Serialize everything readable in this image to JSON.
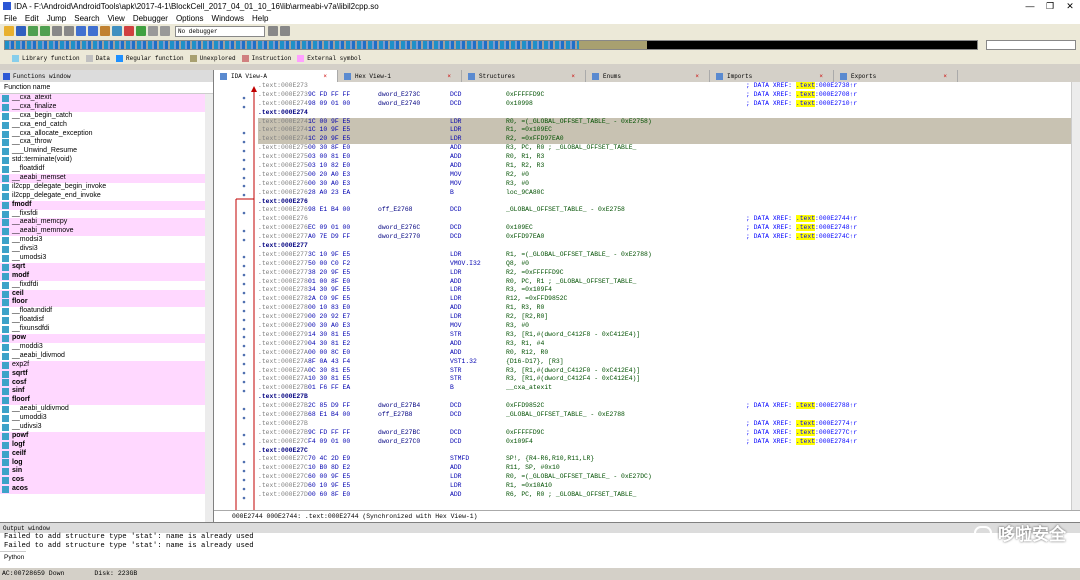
{
  "window": {
    "title": "IDA - F:\\Android\\AndroidTools\\apk\\2017-4-1\\BlockCell_2017_04_01_10_16\\lib\\armeabi-v7a\\libil2cpp.so",
    "min": "—",
    "max": "❐",
    "close": "✕"
  },
  "menu": [
    "File",
    "Edit",
    "Jump",
    "Search",
    "View",
    "Debugger",
    "Options",
    "Windows",
    "Help"
  ],
  "toolbar": {
    "debugger": "No debugger"
  },
  "legend": [
    {
      "label": "Library function",
      "color": "#87ceeb"
    },
    {
      "label": "Data",
      "color": "#c0c0c0"
    },
    {
      "label": "Regular function",
      "color": "#1e90ff"
    },
    {
      "label": "Unexplored",
      "color": "#a8a070"
    },
    {
      "label": "Instruction",
      "color": "#d08080"
    },
    {
      "label": "External symbol",
      "color": "#ffa0ff"
    }
  ],
  "functions": {
    "title": "Functions window",
    "column": "Function name",
    "items": [
      {
        "name": "__cxa_atexit",
        "lib": true
      },
      {
        "name": "__cxa_finalize",
        "lib": true
      },
      {
        "name": "__cxa_begin_catch",
        "lib": false
      },
      {
        "name": "__cxa_end_catch",
        "lib": false
      },
      {
        "name": "__cxa_allocate_exception",
        "lib": false
      },
      {
        "name": "__cxa_throw",
        "lib": false
      },
      {
        "name": "___Unwind_Resume",
        "lib": false
      },
      {
        "name": "std::terminate(void)",
        "lib": false
      },
      {
        "name": "__floatdidf",
        "lib": false
      },
      {
        "name": "__aeabi_memset",
        "lib": true
      },
      {
        "name": "il2cpp_delegate_begin_invoke",
        "lib": false
      },
      {
        "name": "il2cpp_delegate_end_invoke",
        "lib": false
      },
      {
        "name": "fmodf",
        "lib": true,
        "bold": true
      },
      {
        "name": "__fixsfdi",
        "lib": false
      },
      {
        "name": "__aeabi_memcpy",
        "lib": true
      },
      {
        "name": "__aeabi_memmove",
        "lib": true
      },
      {
        "name": "__modsi3",
        "lib": false
      },
      {
        "name": "__divsi3",
        "lib": false
      },
      {
        "name": "__umodsi3",
        "lib": false
      },
      {
        "name": "sqrt",
        "lib": true,
        "bold": true
      },
      {
        "name": "modf",
        "lib": true,
        "bold": true
      },
      {
        "name": "__fixdfdi",
        "lib": false
      },
      {
        "name": "ceil",
        "lib": true,
        "bold": true
      },
      {
        "name": "floor",
        "lib": true,
        "bold": true
      },
      {
        "name": "__floatundidf",
        "lib": false
      },
      {
        "name": "__floatdisf",
        "lib": false
      },
      {
        "name": "__fixunsdfdi",
        "lib": false
      },
      {
        "name": "pow",
        "lib": true,
        "bold": true
      },
      {
        "name": "__moddi3",
        "lib": false
      },
      {
        "name": "__aeabi_ldivmod",
        "lib": false
      },
      {
        "name": "exp2f",
        "lib": true
      },
      {
        "name": "sqrtf",
        "lib": true,
        "bold": true
      },
      {
        "name": "cosf",
        "lib": true,
        "bold": true
      },
      {
        "name": "sinf",
        "lib": true,
        "bold": true
      },
      {
        "name": "floorf",
        "lib": true,
        "bold": true
      },
      {
        "name": "__aeabi_uldivmod",
        "lib": false
      },
      {
        "name": "__umoddi3",
        "lib": false
      },
      {
        "name": "__udivsi3",
        "lib": false
      },
      {
        "name": "powf",
        "lib": true,
        "bold": true
      },
      {
        "name": "logf",
        "lib": true,
        "bold": true
      },
      {
        "name": "ceilf",
        "lib": true,
        "bold": true
      },
      {
        "name": "log",
        "lib": true,
        "bold": true
      },
      {
        "name": "sin",
        "lib": true,
        "bold": true
      },
      {
        "name": "cos",
        "lib": true,
        "bold": true
      },
      {
        "name": "acos",
        "lib": true,
        "bold": true
      }
    ]
  },
  "tabs": [
    {
      "label": "IDA View-A",
      "active": true
    },
    {
      "label": "Hex View-1",
      "active": false
    },
    {
      "label": "Structures",
      "active": false
    },
    {
      "label": "Enums",
      "active": false
    },
    {
      "label": "Imports",
      "active": false
    },
    {
      "label": "Exports",
      "active": false
    }
  ],
  "disasm": [
    {
      "a": ".text:000E2738",
      "b": "",
      "l": "",
      "m": "",
      "o": "",
      "c": "; DATA XREF: .text:000E2738↑r"
    },
    {
      "a": ".text:000E273C",
      "b": "9C FD FF FF",
      "l": "dword_E273C",
      "m": "DCD",
      "o": "0xFFFFFD9C",
      "c": "; DATA XREF: .text:000E2708↑r"
    },
    {
      "a": ".text:000E2740",
      "b": "98 09 01 00",
      "l": "dword_E2740",
      "m": "DCD",
      "o": "0x10998",
      "c": "; DATA XREF: .text:000E2710↑r"
    },
    {
      "a": ".text:000E2744",
      "b": "",
      "l": "",
      "m": "",
      "o": "",
      "c": "",
      "lbl": true
    },
    {
      "a": ".text:000E2744",
      "b": "1C 00 9F E5",
      "l": "",
      "m": "LDR",
      "o": "R0, =(_GLOBAL_OFFSET_TABLE_ - 0xE2758)",
      "c": "",
      "hl": true
    },
    {
      "a": ".text:000E2748",
      "b": "1C 10 9F E5",
      "l": "",
      "m": "LDR",
      "o": "R1, =0x109EC",
      "c": "",
      "hl": true
    },
    {
      "a": ".text:000E274C",
      "b": "1C 20 9F E5",
      "l": "",
      "m": "LDR",
      "o": "R2, =0xFFD97EA0",
      "c": "",
      "hl": true
    },
    {
      "a": ".text:000E2750",
      "b": "00 30 8F E0",
      "l": "",
      "m": "ADD",
      "o": "R3, PC, R0 ; _GLOBAL_OFFSET_TABLE_",
      "c": ""
    },
    {
      "a": ".text:000E2754",
      "b": "03 00 81 E0",
      "l": "",
      "m": "ADD",
      "o": "R0, R1, R3",
      "c": ""
    },
    {
      "a": ".text:000E2758",
      "b": "03 10 82 E0",
      "l": "",
      "m": "ADD",
      "o": "R1, R2, R3",
      "c": ""
    },
    {
      "a": ".text:000E275C",
      "b": "00 20 A0 E3",
      "l": "",
      "m": "MOV",
      "o": "R2, #0",
      "c": ""
    },
    {
      "a": ".text:000E2760",
      "b": "00 30 A0 E3",
      "l": "",
      "m": "MOV",
      "o": "R3, #0",
      "c": ""
    },
    {
      "a": ".text:000E2764",
      "b": "28 A0 23 EA",
      "l": "",
      "m": "B",
      "o": "loc_9CA80C",
      "c": ""
    },
    {
      "a": ".text:000E2764",
      "b": "",
      "l": "",
      "m": "",
      "o": "",
      "c": "",
      "lbl": true
    },
    {
      "a": ".text:000E2768",
      "b": "98 E1 B4 00",
      "l": "off_E2768",
      "m": "DCD",
      "o": "_GLOBAL_OFFSET_TABLE_ - 0xE2758",
      "c": ""
    },
    {
      "a": ".text:000E2768",
      "b": "",
      "l": "",
      "m": "",
      "o": "",
      "c": "; DATA XREF: .text:000E2744↑r"
    },
    {
      "a": ".text:000E276C",
      "b": "EC 09 01 00",
      "l": "dword_E276C",
      "m": "DCD",
      "o": "0x109EC",
      "c": "; DATA XREF: .text:000E2748↑r"
    },
    {
      "a": ".text:000E2770",
      "b": "A0 7E D9 FF",
      "l": "dword_E2770",
      "m": "DCD",
      "o": "0xFFD97EA0",
      "c": "; DATA XREF: .text:000E274C↑r"
    },
    {
      "a": ".text:000E2774",
      "b": "",
      "l": "",
      "m": "",
      "o": "",
      "c": "",
      "lbl": true
    },
    {
      "a": ".text:000E2774",
      "b": "3C 10 9F E5",
      "l": "",
      "m": "LDR",
      "o": "R1, =(_GLOBAL_OFFSET_TABLE_ - 0xE2788)",
      "c": ""
    },
    {
      "a": ".text:000E2778",
      "b": "50 00 C0 F2",
      "l": "",
      "m": "VMOV.I32",
      "o": "Q8, #0",
      "c": ""
    },
    {
      "a": ".text:000E277C",
      "b": "38 20 9F E5",
      "l": "",
      "m": "LDR",
      "o": "R2, =0xFFFFFD9C",
      "c": ""
    },
    {
      "a": ".text:000E2780",
      "b": "01 00 8F E0",
      "l": "",
      "m": "ADD",
      "o": "R0, PC, R1 ; _GLOBAL_OFFSET_TABLE_",
      "c": ""
    },
    {
      "a": ".text:000E2784",
      "b": "34 30 9F E5",
      "l": "",
      "m": "LDR",
      "o": "R3, =0x109F4",
      "c": ""
    },
    {
      "a": ".text:000E2788",
      "b": "2A C0 9F E5",
      "l": "",
      "m": "LDR",
      "o": "R12, =0xFFD9852C",
      "c": ""
    },
    {
      "a": ".text:000E278C",
      "b": "00 10 83 E0",
      "l": "",
      "m": "ADD",
      "o": "R1, R3, R0",
      "c": ""
    },
    {
      "a": ".text:000E2790",
      "b": "00 20 92 E7",
      "l": "",
      "m": "LDR",
      "o": "R2, [R2,R0]",
      "c": ""
    },
    {
      "a": ".text:000E2794",
      "b": "00 30 A0 E3",
      "l": "",
      "m": "MOV",
      "o": "R3, #0",
      "c": ""
    },
    {
      "a": ".text:000E2798",
      "b": "14 30 81 E5",
      "l": "",
      "m": "STR",
      "o": "R3, [R1,#(dword_C412F8 - 0xC412E4)]",
      "c": ""
    },
    {
      "a": ".text:000E279C",
      "b": "04 30 81 E2",
      "l": "",
      "m": "ADD",
      "o": "R3, R1, #4",
      "c": ""
    },
    {
      "a": ".text:000E27A0",
      "b": "00 00 8C E0",
      "l": "",
      "m": "ADD",
      "o": "R0, R12, R0",
      "c": ""
    },
    {
      "a": ".text:000E27A4",
      "b": "8F 0A 43 F4",
      "l": "",
      "m": "VST1.32",
      "o": "{D16-D17}, [R3]",
      "c": ""
    },
    {
      "a": ".text:000E27A8",
      "b": "0C 30 81 E5",
      "l": "",
      "m": "STR",
      "o": "R3, [R1,#(dword_C412F0 - 0xC412E4)]",
      "c": ""
    },
    {
      "a": ".text:000E27AC",
      "b": "10 30 81 E5",
      "l": "",
      "m": "STR",
      "o": "R3, [R1,#(dword_C412F4 - 0xC412E4)]",
      "c": ""
    },
    {
      "a": ".text:000E27B0",
      "b": "01 F6 FF EA",
      "l": "",
      "m": "B",
      "o": "__cxa_atexit",
      "c": ""
    },
    {
      "a": ".text:000E27B0",
      "b": "",
      "l": "",
      "m": "",
      "o": "",
      "c": "",
      "lbl": true
    },
    {
      "a": ".text:000E27B4",
      "b": "2C 85 D9 FF",
      "l": "dword_E27B4",
      "m": "DCD",
      "o": "0xFFD9852C",
      "c": "; DATA XREF: .text:000E2788↑r"
    },
    {
      "a": ".text:000E27B8",
      "b": "68 E1 B4 00",
      "l": "off_E27B8",
      "m": "DCD",
      "o": "_GLOBAL_OFFSET_TABLE_ - 0xE2788",
      "c": ""
    },
    {
      "a": ".text:000E27B8",
      "b": "",
      "l": "",
      "m": "",
      "o": "",
      "c": "; DATA XREF: .text:000E2774↑r"
    },
    {
      "a": ".text:000E27BC",
      "b": "9C FD FF FF",
      "l": "dword_E27BC",
      "m": "DCD",
      "o": "0xFFFFFD9C",
      "c": "; DATA XREF: .text:000E277C↑r"
    },
    {
      "a": ".text:000E27C0",
      "b": "F4 09 01 00",
      "l": "dword_E27C0",
      "m": "DCD",
      "o": "0x109F4",
      "c": "; DATA XREF: .text:000E2784↑r"
    },
    {
      "a": ".text:000E27C4",
      "b": "",
      "l": "",
      "m": "",
      "o": "",
      "c": "",
      "lbl": true
    },
    {
      "a": ".text:000E27C4",
      "b": "70 4C 2D E9",
      "l": "",
      "m": "STMFD",
      "o": "SP!, {R4-R6,R10,R11,LR}",
      "c": ""
    },
    {
      "a": ".text:000E27C8",
      "b": "10 B0 8D E2",
      "l": "",
      "m": "ADD",
      "o": "R11, SP, #0x10",
      "c": ""
    },
    {
      "a": ".text:000E27CC",
      "b": "60 00 9F E5",
      "l": "",
      "m": "LDR",
      "o": "R0, =(_GLOBAL_OFFSET_TABLE_ - 0xE27DC)",
      "c": ""
    },
    {
      "a": ".text:000E27D0",
      "b": "60 10 9F E5",
      "l": "",
      "m": "LDR",
      "o": "R1, =0x10A10",
      "c": ""
    },
    {
      "a": ".text:000E27D4",
      "b": "00 60 8F E0",
      "l": "",
      "m": "ADD",
      "o": "R6, PC, R0 ; _GLOBAL_OFFSET_TABLE_",
      "c": ""
    }
  ],
  "sync": "000E2744 000E2744: .text:000E2744 (Synchronized with Hex View-1)",
  "output": {
    "title": "Output window",
    "lines": [
      "Failed to add structure type 'stat': name is already used",
      "Failed to add structure type 'stat': name is already used"
    ],
    "python": "Python"
  },
  "status": {
    "state": "AC:00728659 Down",
    "disk": "Disk: 223GB"
  },
  "watermark": "哆啦安全"
}
